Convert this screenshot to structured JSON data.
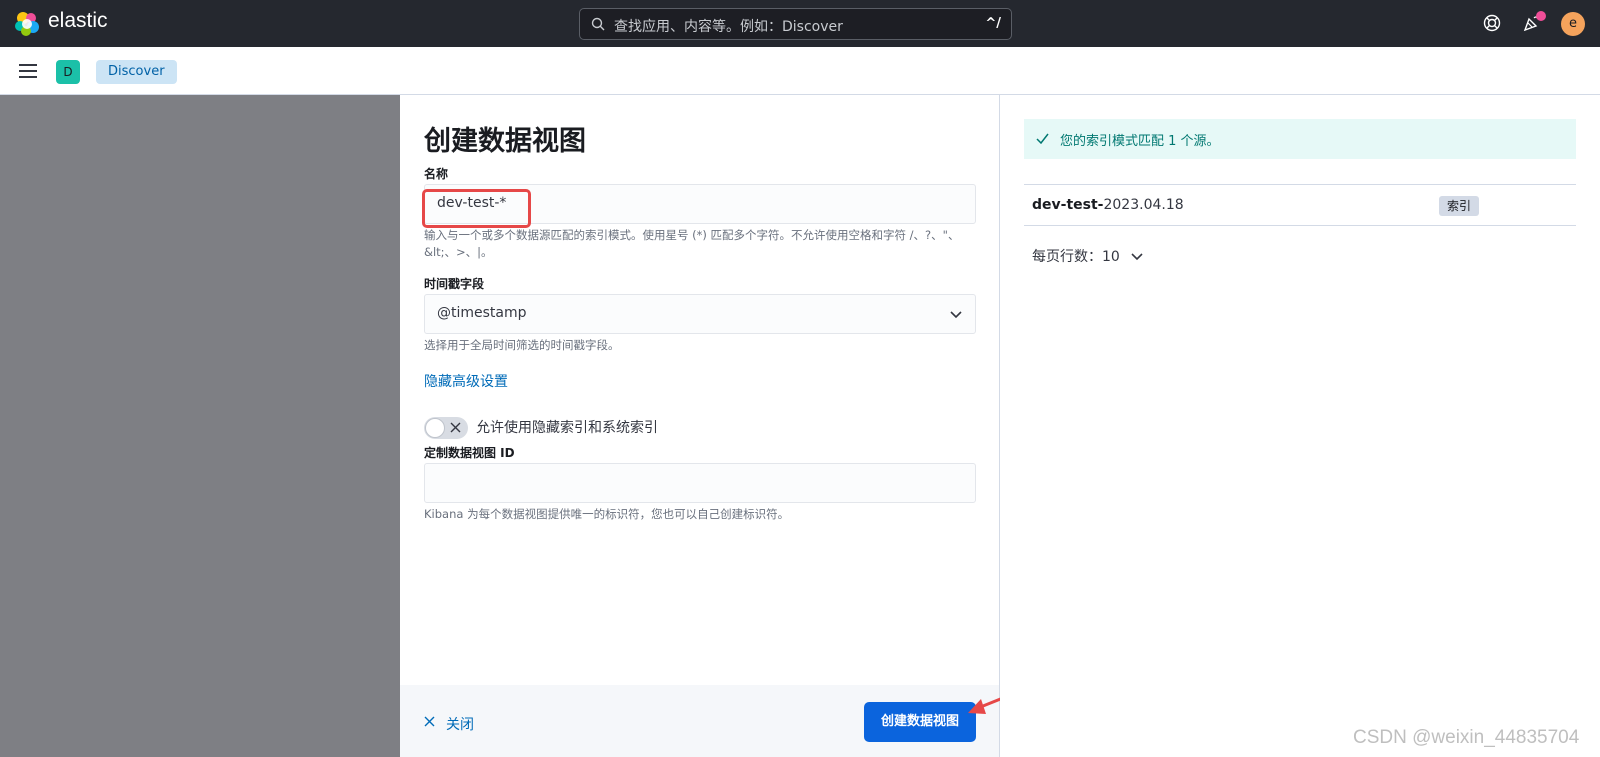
{
  "header": {
    "brand": "elastic",
    "search_placeholder": "查找应用、内容等。例如：Discover",
    "search_shortcut": "^/",
    "avatar_initial": "e"
  },
  "subbar": {
    "space_initial": "D",
    "breadcrumb": "Discover"
  },
  "form": {
    "title": "创建数据视图",
    "name_label": "名称",
    "name_value": "dev-test-*",
    "name_help": "输入与一个或多个数据源匹配的索引模式。使用星号 (*) 匹配多个字符。不允许使用空格和字符 /、?、\"、&lt;、>、|。",
    "timestamp_label": "时间戳字段",
    "timestamp_value": "@timestamp",
    "timestamp_help": "选择用于全局时间筛选的时间戳字段。",
    "advanced_link": "隐藏高级设置",
    "toggle_label": "允许使用隐藏索引和系统索引",
    "custom_id_label": "定制数据视图 ID",
    "custom_id_value": "",
    "custom_id_help": "Kibana 为每个数据视图提供唯一的标识符，您也可以自己创建标识符。",
    "close_label": "关闭",
    "create_label": "创建数据视图"
  },
  "results": {
    "callout": "您的索引模式匹配 1 个源。",
    "index_prefix": "dev-test-",
    "index_suffix": "2023.04.18",
    "index_type": "索引",
    "rows_per_page": "每页行数：10"
  },
  "watermark": "CSDN @weixin_44835704",
  "colors": {
    "accent": "#0b64dd",
    "link": "#006bb8",
    "success": "#007871",
    "highlight": "#e64848"
  }
}
